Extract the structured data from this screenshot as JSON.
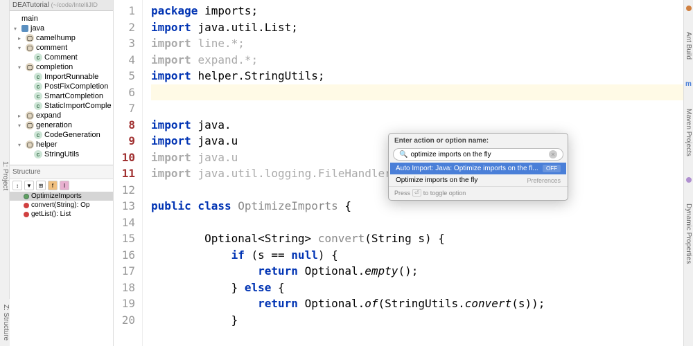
{
  "leftGutter": "1: Project",
  "sidebar": {
    "header": "DEATutorial",
    "path": "(~/code/IntelliJID",
    "tree": [
      {
        "level": 0,
        "label": "main",
        "arrow": ""
      },
      {
        "level": 0,
        "label": "java",
        "arrow": "▾",
        "icon": "java"
      },
      {
        "level": 1,
        "label": "camelhump",
        "arrow": "▸",
        "icon": "pkg"
      },
      {
        "level": 1,
        "label": "comment",
        "arrow": "▾",
        "icon": "pkg"
      },
      {
        "level": 2,
        "label": "Comment",
        "arrow": "",
        "icon": "class"
      },
      {
        "level": 1,
        "label": "completion",
        "arrow": "▾",
        "icon": "pkg"
      },
      {
        "level": 2,
        "label": "ImportRunnable",
        "arrow": "",
        "icon": "class"
      },
      {
        "level": 2,
        "label": "PostFixCompletion",
        "arrow": "",
        "icon": "class"
      },
      {
        "level": 2,
        "label": "SmartCompletion",
        "arrow": "",
        "icon": "class"
      },
      {
        "level": 2,
        "label": "StaticImportComple",
        "arrow": "",
        "icon": "class"
      },
      {
        "level": 1,
        "label": "expand",
        "arrow": "▸",
        "icon": "pkg"
      },
      {
        "level": 1,
        "label": "generation",
        "arrow": "▾",
        "icon": "pkg"
      },
      {
        "level": 2,
        "label": "CodeGeneration",
        "arrow": "",
        "icon": "class"
      },
      {
        "level": 1,
        "label": "helper",
        "arrow": "▾",
        "icon": "pkg"
      },
      {
        "level": 2,
        "label": "StringUtils",
        "arrow": "",
        "icon": "class"
      }
    ],
    "structureTitle": "Structure",
    "structure": [
      {
        "label": "OptimizeImports",
        "icon": "c",
        "sel": true
      },
      {
        "label": "convert(String): Op",
        "icon": "r"
      },
      {
        "label": "getList(): List<Inte",
        "icon": "r"
      }
    ]
  },
  "bottomGutter": "Z: Structure",
  "code": {
    "lines": [
      [
        {
          "t": "package ",
          "c": "kw"
        },
        {
          "t": "imports;"
        }
      ],
      [
        {
          "t": "import ",
          "c": "kw"
        },
        {
          "t": "java.util.List;"
        }
      ],
      [
        {
          "t": "import ",
          "c": "kw gray"
        },
        {
          "t": "line.*;",
          "c": "gray"
        }
      ],
      [
        {
          "t": "import ",
          "c": "kw gray"
        },
        {
          "t": "expand.*;",
          "c": "gray"
        }
      ],
      [
        {
          "t": "import ",
          "c": "kw"
        },
        {
          "t": "helper.StringUtils;"
        }
      ],
      [
        {
          "t": ""
        }
      ],
      [
        {
          "t": ""
        }
      ],
      [
        {
          "t": "import ",
          "c": "kw"
        },
        {
          "t": "java."
        }
      ],
      [
        {
          "t": "import ",
          "c": "kw"
        },
        {
          "t": "java.u                              iteArrayList;"
        }
      ],
      [
        {
          "t": "import ",
          "c": "kw gray"
        },
        {
          "t": "java.u                              Service;",
          "c": "gray"
        }
      ],
      [
        {
          "t": "import ",
          "c": "kw gray"
        },
        {
          "t": "java.util.logging.FileHandler;",
          "c": "gray"
        }
      ],
      [
        {
          "t": ""
        }
      ],
      [
        {
          "t": "public class ",
          "c": "kw"
        },
        {
          "t": "OptimizeImports ",
          "c": "ty"
        },
        {
          "t": "{"
        }
      ],
      [
        {
          "t": ""
        }
      ],
      [
        {
          "t": "        Optional<String> "
        },
        {
          "t": "convert",
          "c": "ty"
        },
        {
          "t": "(String s) {"
        }
      ],
      [
        {
          "t": "            "
        },
        {
          "t": "if ",
          "c": "kw"
        },
        {
          "t": "(s == "
        },
        {
          "t": "null",
          "c": "kw"
        },
        {
          "t": ") {"
        }
      ],
      [
        {
          "t": "                "
        },
        {
          "t": "return ",
          "c": "kw"
        },
        {
          "t": "Optional."
        },
        {
          "t": "empty",
          "c": "it"
        },
        {
          "t": "();"
        }
      ],
      [
        {
          "t": "            } "
        },
        {
          "t": "else ",
          "c": "kw"
        },
        {
          "t": "{"
        }
      ],
      [
        {
          "t": "                "
        },
        {
          "t": "return ",
          "c": "kw"
        },
        {
          "t": "Optional."
        },
        {
          "t": "of",
          "c": "it"
        },
        {
          "t": "(StringUtils."
        },
        {
          "t": "convert",
          "c": "it"
        },
        {
          "t": "(s));"
        }
      ],
      [
        {
          "t": "            }"
        }
      ]
    ],
    "hlLine": 6
  },
  "popup": {
    "title": "Enter action or option name:",
    "search": "optimize imports on the fly",
    "items": [
      {
        "label": "Auto Import: Java: Optimize imports on the fl...",
        "badge": "OFF",
        "sel": true
      },
      {
        "label": "Optimize imports on the fly",
        "badge": "Preferences",
        "sel": false
      }
    ],
    "footer": "Press  to toggle option",
    "kbd": "⏎"
  },
  "rightGutter": {
    "ant": "Ant Build",
    "maven": "Maven Projects",
    "dyn": "Dynamic Properties"
  }
}
